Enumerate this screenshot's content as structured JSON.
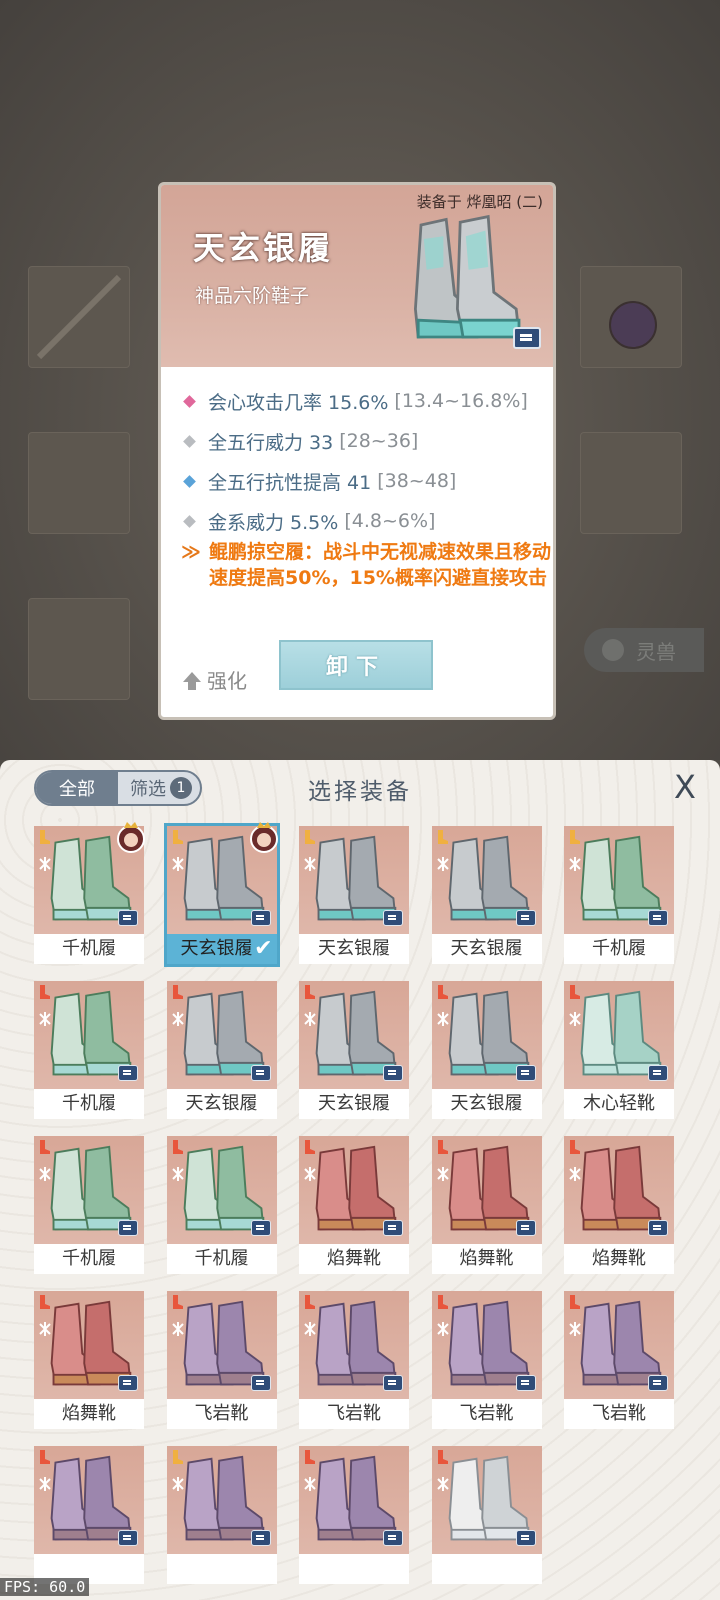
{
  "detail": {
    "equipped_by": "装备于 烨凰昭 (二)",
    "name": "天玄银履",
    "subtitle": "神品六阶鞋子",
    "attributes": [
      {
        "text": "会心攻击几率 15.6%",
        "range": "[13.4~16.8%]",
        "color": "#e0689b"
      },
      {
        "text": "全五行威力 33",
        "range": "[28~36]",
        "color": "#b9bcc0"
      },
      {
        "text": "全五行抗性提高 41",
        "range": "[38~48]",
        "color": "#5aa3d8"
      },
      {
        "text": "金系威力 5.5%",
        "range": "[4.8~6%]",
        "color": "#b9bcc0"
      }
    ],
    "special_effect": "鲲鹏掠空履：战斗中无视减速效果且移动速度提高50%，15%概率闪避直接攻击",
    "enhance_label": "强化",
    "unequip_label": "卸下"
  },
  "background": {
    "beast_button": "灵兽"
  },
  "panel": {
    "tab_all": "全部",
    "tab_filter": "筛选",
    "filter_count": "1",
    "title": "选择装备",
    "close": "X"
  },
  "items": [
    {
      "name": "千机履",
      "type": "green",
      "avatar": true,
      "slot_color": "#f0b040"
    },
    {
      "name": "天玄银履",
      "type": "silver",
      "avatar": true,
      "selected": true,
      "slot_color": "#f0b040"
    },
    {
      "name": "天玄银履",
      "type": "silver",
      "slot_color": "#f0b040"
    },
    {
      "name": "天玄银履",
      "type": "silver",
      "slot_color": "#f0b040"
    },
    {
      "name": "千机履",
      "type": "green",
      "slot_color": "#f0b040"
    },
    {
      "name": "千机履",
      "type": "green",
      "slot_color": "#e8563c"
    },
    {
      "name": "天玄银履",
      "type": "silver",
      "slot_color": "#e8563c"
    },
    {
      "name": "天玄银履",
      "type": "silver",
      "slot_color": "#e8563c"
    },
    {
      "name": "天玄银履",
      "type": "silver",
      "slot_color": "#e8563c"
    },
    {
      "name": "木心轻靴",
      "type": "mint",
      "slot_color": "#e8563c"
    },
    {
      "name": "千机履",
      "type": "green",
      "slot_color": "#e8563c"
    },
    {
      "name": "千机履",
      "type": "green",
      "slot_color": "#e8563c"
    },
    {
      "name": "焰舞靴",
      "type": "red",
      "slot_color": "#e8563c"
    },
    {
      "name": "焰舞靴",
      "type": "red",
      "slot_color": "#e8563c"
    },
    {
      "name": "焰舞靴",
      "type": "red",
      "slot_color": "#e8563c"
    },
    {
      "name": "焰舞靴",
      "type": "red",
      "slot_color": "#e8563c"
    },
    {
      "name": "飞岩靴",
      "type": "purple",
      "slot_color": "#e8563c"
    },
    {
      "name": "飞岩靴",
      "type": "purple",
      "slot_color": "#e8563c"
    },
    {
      "name": "飞岩靴",
      "type": "purple",
      "slot_color": "#e8563c"
    },
    {
      "name": "飞岩靴",
      "type": "purple",
      "slot_color": "#e8563c"
    },
    {
      "name": "",
      "type": "purple",
      "slot_color": "#e8563c"
    },
    {
      "name": "",
      "type": "purple",
      "slot_color": "#f0b040"
    },
    {
      "name": "",
      "type": "purple",
      "slot_color": "#e8563c"
    },
    {
      "name": "",
      "type": "white",
      "slot_color": "#e8563c"
    }
  ],
  "fps": "FPS: 60.0",
  "colors": {
    "accent_blue": "#4fa6c9",
    "special_orange": "#ef7a12",
    "attr_text": "#4b6c86"
  }
}
